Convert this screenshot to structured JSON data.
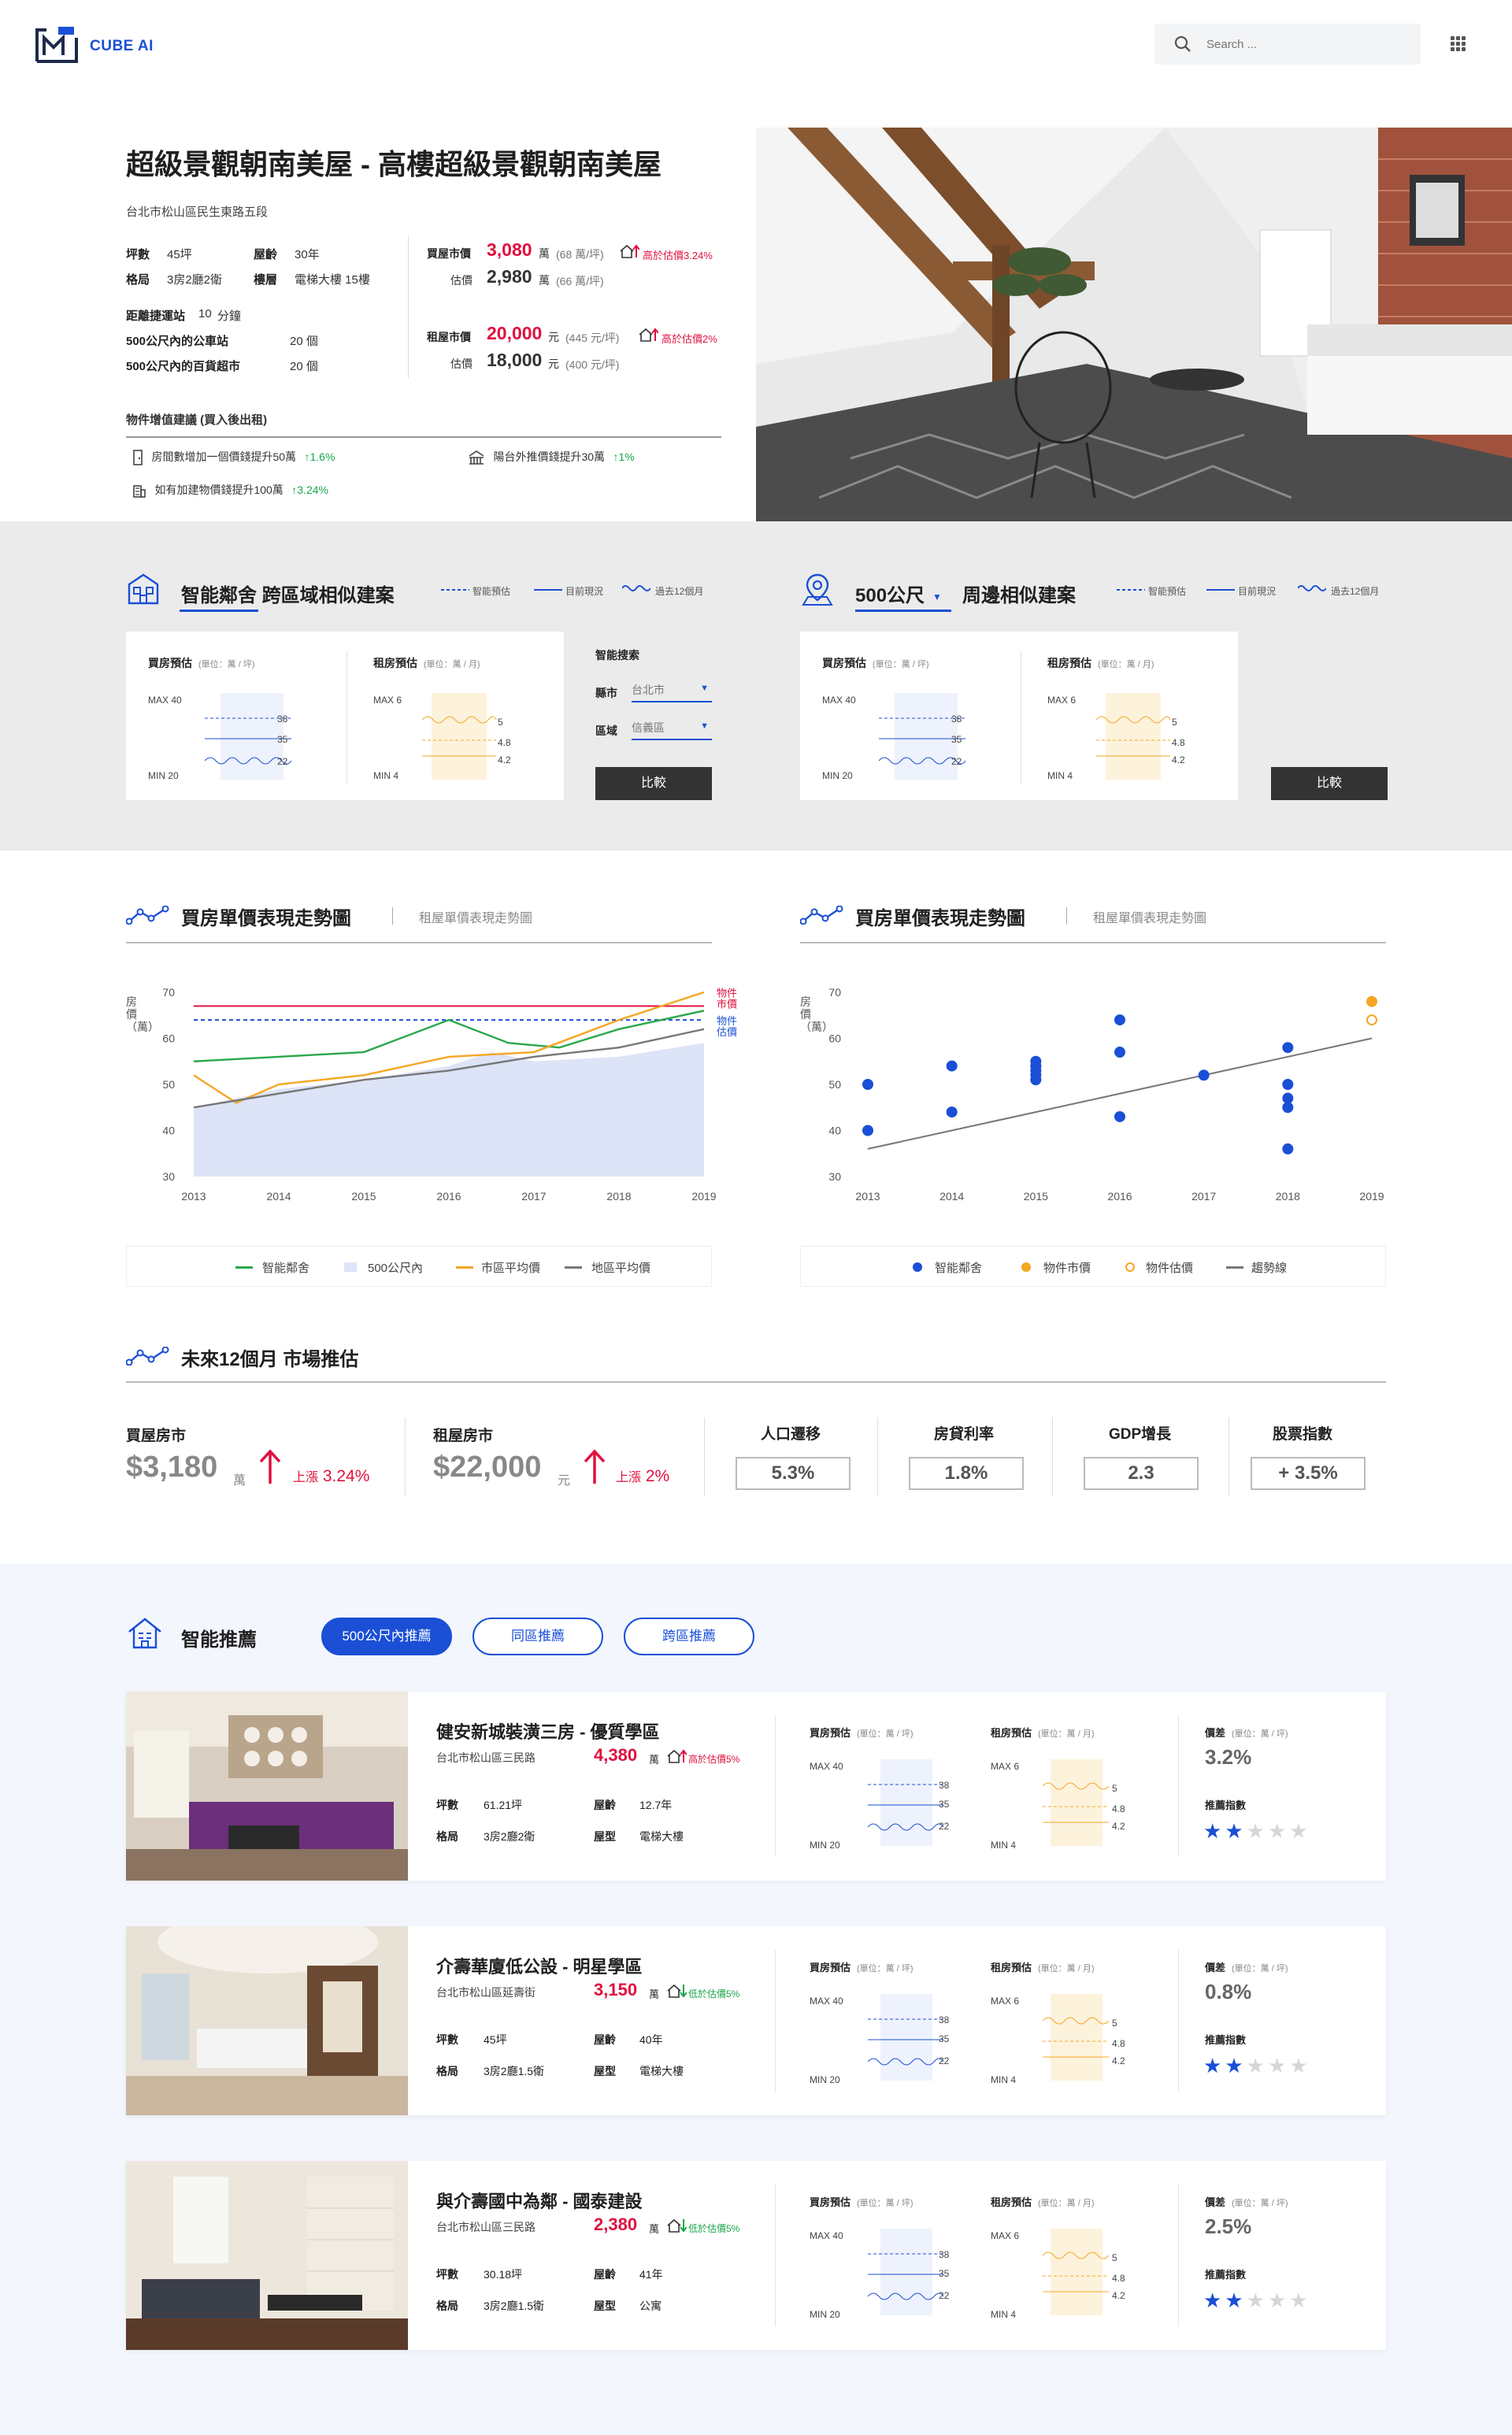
{
  "brand": {
    "name": "CUBE AI"
  },
  "search": {
    "placeholder": "Search ..."
  },
  "hero": {
    "title": "超級景觀朝南美屋 - 高樓超級景觀朝南美屋",
    "address": "台北市松山區民生東路五段",
    "specs": {
      "area_label": "坪數",
      "area": "45坪",
      "age_label": "屋齡",
      "age": "30年",
      "layout_label": "格局",
      "layout": "3房2廳2衛",
      "floor_label": "樓層",
      "floor": "電梯大樓 15樓"
    },
    "transit": {
      "label": "距離捷運站",
      "value": "10",
      "unit": "分鐘"
    },
    "bus": {
      "label": "500公尺內的公車站",
      "value": "20 個"
    },
    "mall": {
      "label": "500公尺內的百貨超市",
      "value": "20 個"
    },
    "buy": {
      "label": "買屋市價",
      "price": "3,080",
      "unit": "萬",
      "per": "(68 萬/坪)",
      "tag": "高於估價3.24%",
      "est_label": "估價",
      "est": "2,980",
      "est_unit": "萬",
      "est_per": "(66 萬/坪)"
    },
    "rent": {
      "label": "租屋市價",
      "price": "20,000",
      "unit": "元",
      "per": "(445 元/坪)",
      "tag": "高於估價2%",
      "est_label": "估價",
      "est": "18,000",
      "est_unit": "元",
      "est_per": "(400 元/坪)"
    },
    "advice": {
      "title": "物件增值建議 (買入後出租)",
      "items": [
        {
          "text": "房間數增加一個價錢提升50萬",
          "delta": "1.6%"
        },
        {
          "text": "陽台外推價錢提升30萬",
          "delta": "1%"
        },
        {
          "text": "如有加建物價錢提升100萬",
          "delta": "3.24%"
        }
      ]
    }
  },
  "similar": {
    "left_title": "智能鄰舍 跨區域相似建案",
    "right_title_a": "500公尺",
    "right_title_b": "周邊相似建案",
    "legend": [
      "智能預估",
      "目前現況",
      "過去12個月"
    ],
    "buy_label": "買房預估",
    "buy_unit": "(單位：萬 / 坪)",
    "rent_label": "租房預估",
    "rent_unit": "(單位：萬 / 月)",
    "buy_max": "MAX  40",
    "buy_min": "MIN  20",
    "buy_vals": [
      "38",
      "35",
      "22"
    ],
    "rent_max": "MAX  6",
    "rent_min": "MIN  4",
    "rent_vals": [
      "5",
      "4.8",
      "4.2"
    ],
    "search_title": "智能搜索",
    "county_label": "縣市",
    "county_value": "台北市",
    "district_label": "區域",
    "district_value": "信義區",
    "compare": "比較"
  },
  "trend_left": {
    "title": "買房單價表現走勢圖",
    "sub": "租屋單價表現走勢圖",
    "ylabel": "房價（萬）",
    "end_labels": [
      "物件",
      "市價",
      "物件",
      "估價"
    ],
    "legend": [
      "智能鄰舍",
      "500公尺內",
      "市區平均價",
      "地區平均價"
    ]
  },
  "trend_right": {
    "title": "買房單價表現走勢圖",
    "sub": "租屋單價表現走勢圖",
    "ylabel": "房價（萬）",
    "legend": [
      "智能鄰舍",
      "物件市價",
      "物件估價",
      "趨勢線"
    ]
  },
  "chart_data": [
    {
      "type": "line",
      "x": [
        2013,
        2014,
        2015,
        2016,
        2017,
        2018,
        2019
      ],
      "ylim": [
        30,
        70
      ],
      "yticks": [
        30,
        40,
        50,
        60,
        70
      ],
      "ylabel": "房價（萬）",
      "series": [
        {
          "name": "智能鄰舍",
          "color": "#2aa84a",
          "points": [
            [
              2013,
              55
            ],
            [
              2014,
              56
            ],
            [
              2015,
              57
            ],
            [
              2016,
              64
            ],
            [
              2016.7,
              59
            ],
            [
              2017.3,
              58
            ],
            [
              2018,
              62
            ],
            [
              2019,
              66
            ]
          ]
        },
        {
          "name": "500公尺內",
          "color": "#dde4f7",
          "points": [
            [
              2013,
              45
            ],
            [
              2014,
              49
            ],
            [
              2015,
              51
            ],
            [
              2016,
              54
            ],
            [
              2016.5,
              57
            ],
            [
              2017,
              55
            ],
            [
              2018,
              56
            ],
            [
              2019,
              59
            ]
          ]
        },
        {
          "name": "市區平均價",
          "color": "#f5a623",
          "points": [
            [
              2013,
              52
            ],
            [
              2013.5,
              46
            ],
            [
              2014,
              50
            ],
            [
              2015,
              52
            ],
            [
              2016,
              56
            ],
            [
              2017,
              57
            ],
            [
              2018,
              64
            ],
            [
              2019,
              70
            ]
          ]
        },
        {
          "name": "地區平均價",
          "color": "#777777",
          "points": [
            [
              2013,
              45
            ],
            [
              2014,
              48
            ],
            [
              2015,
              51
            ],
            [
              2016,
              53
            ],
            [
              2017,
              56
            ],
            [
              2018,
              58
            ],
            [
              2019,
              62
            ]
          ]
        }
      ],
      "reference_lines": [
        {
          "name": "物件市價",
          "value": 67,
          "color": "#e0103e"
        },
        {
          "name": "物件估價",
          "value": 64,
          "color": "#1a4fd6"
        }
      ]
    },
    {
      "type": "scatter",
      "x": [
        2013,
        2014,
        2015,
        2016,
        2017,
        2018,
        2019
      ],
      "ylim": [
        30,
        70
      ],
      "yticks": [
        30,
        40,
        50,
        60,
        70
      ],
      "ylabel": "房價（萬）",
      "series": [
        {
          "name": "智能鄰舍",
          "color": "#1a4fd6",
          "points": [
            [
              2013,
              50
            ],
            [
              2013,
              40
            ],
            [
              2014,
              54
            ],
            [
              2014,
              44
            ],
            [
              2015,
              55
            ],
            [
              2015,
              54
            ],
            [
              2015,
              53
            ],
            [
              2015,
              52
            ],
            [
              2015,
              51
            ],
            [
              2016,
              64
            ],
            [
              2016,
              57
            ],
            [
              2016,
              43
            ],
            [
              2017,
              52
            ],
            [
              2018,
              58
            ],
            [
              2018,
              50
            ],
            [
              2018,
              47
            ],
            [
              2018,
              45
            ],
            [
              2018,
              36
            ]
          ]
        },
        {
          "name": "物件市價",
          "color": "#f5a623",
          "points": [
            [
              2019,
              68
            ]
          ]
        },
        {
          "name": "物件估價",
          "color": "#f5a623",
          "hollow": true,
          "points": [
            [
              2019,
              64
            ]
          ]
        }
      ],
      "trendline": {
        "name": "趨勢線",
        "from": [
          2013,
          36
        ],
        "to": [
          2019,
          60
        ],
        "color": "#777777"
      }
    }
  ],
  "forecast": {
    "title": "未來12個月 市場推估",
    "buy": {
      "label": "買屋房市",
      "value": "$3,180",
      "unit": "萬",
      "change": "上漲",
      "pct": "3.24%"
    },
    "rent": {
      "label": "租屋房市",
      "value": "$22,000",
      "unit": "元",
      "change": "上漲",
      "pct": "2%"
    },
    "metrics": [
      {
        "label": "人口遷移",
        "value": "5.3%"
      },
      {
        "label": "房貸利率",
        "value": "1.8%"
      },
      {
        "label": "GDP增長",
        "value": "2.3"
      },
      {
        "label": "股票指數",
        "value": "+ 3.5%"
      }
    ]
  },
  "recommend": {
    "title": "智能推薦",
    "tabs": [
      "500公尺內推薦",
      "同區推薦",
      "跨區推薦"
    ],
    "labels": {
      "buy": "買房預估",
      "buy_unit": "(單位：萬 / 坪)",
      "rent": "租房預估",
      "rent_unit": "(單位：萬 / 月)",
      "diff": "價差",
      "diff_unit": "(單位：萬 / 坪)",
      "score": "推薦指數",
      "area": "坪數",
      "age": "屋齡",
      "layout": "格局",
      "type": "屋型",
      "wan": "萬"
    },
    "items": [
      {
        "title": "健安新城裝潢三房 - 優質學區",
        "address": "台北市松山區三民路",
        "price": "4,380",
        "tag": "高於估價5%",
        "area": "61.21坪",
        "age": "12.7年",
        "layout": "3房2廳2衛",
        "type": "電梯大樓",
        "diff": "3.2%",
        "stars": 2
      },
      {
        "title": "介壽華廈低公設 - 明星學區",
        "address": "台北市松山區延壽街",
        "price": "3,150",
        "tag": "低於估價5%",
        "area": "45坪",
        "age": "40年",
        "layout": "3房2廳1.5衛",
        "type": "電梯大樓",
        "diff": "0.8%",
        "stars": 2
      },
      {
        "title": "與介壽國中為鄰 - 國泰建設",
        "address": "台北市松山區三民路",
        "price": "2,380",
        "tag": "低於估價5%",
        "area": "30.18坪",
        "age": "41年",
        "layout": "3房2廳1.5衛",
        "type": "公寓",
        "diff": "2.5%",
        "stars": 2
      }
    ]
  }
}
